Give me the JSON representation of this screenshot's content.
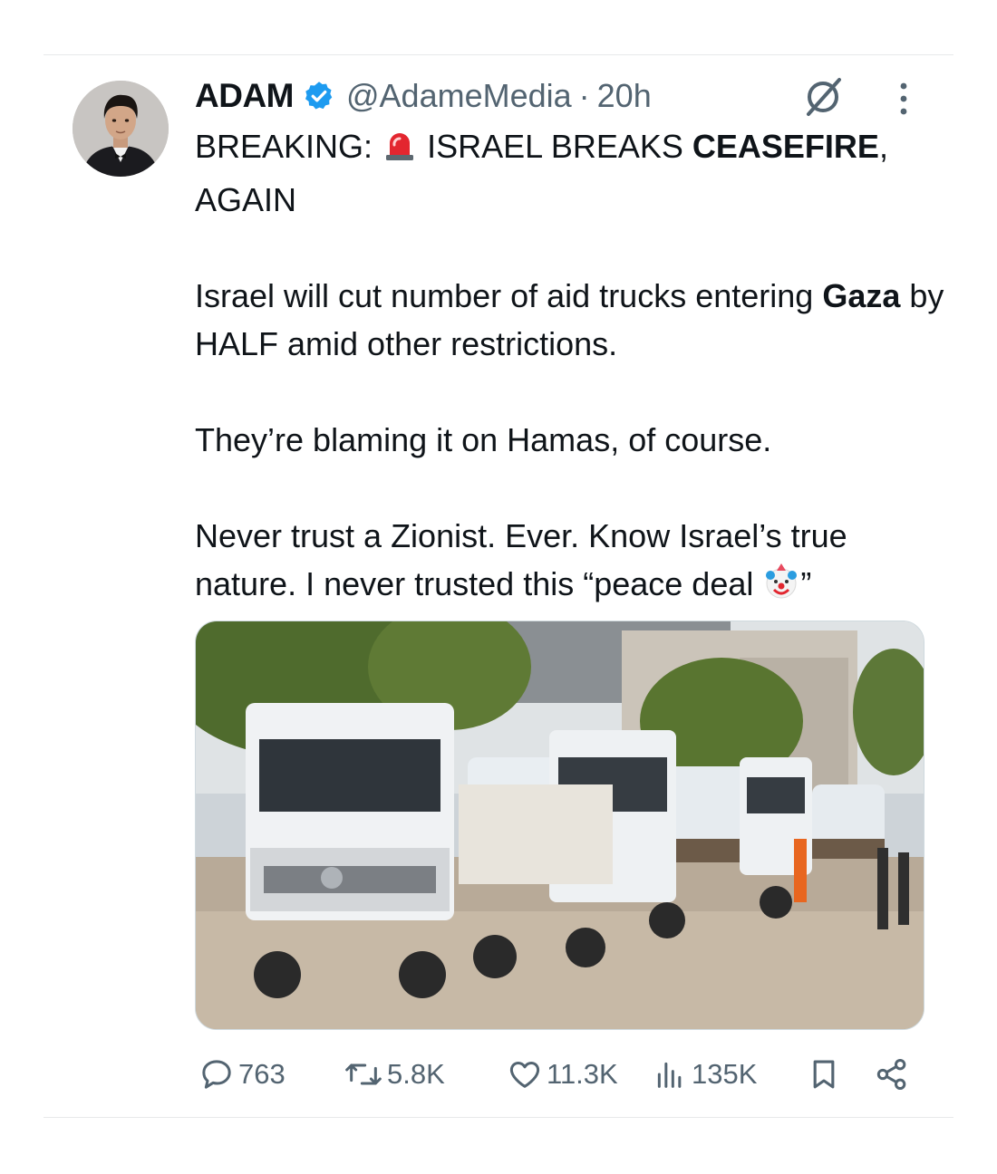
{
  "author": {
    "name": "ADAM",
    "handle": "@AdameMedia",
    "separator": "·",
    "time": "20h"
  },
  "tweet": {
    "line1_prefix": "BREAKING:",
    "line1_mid": "ISRAEL BREAKS",
    "line1_bold": "CEASEFIRE",
    "line1_suffix": ",",
    "line2": "AGAIN",
    "p2_text": "Israel will cut number of aid trucks entering",
    "p2_bold": "Gaza",
    "p2_rest": "by HALF amid other restrictions.",
    "p3": "They’re blaming it on Hamas, of course.",
    "p4_line1": "Never trust a Zionist. Ever. Know Israel’s true",
    "p4_line2": "nature. I never trusted this “peace deal",
    "p4_close": "”"
  },
  "icons": {
    "verified": "verified-badge-icon",
    "siren": "police-light-emoji",
    "clown": "clown-face-emoji",
    "grok": "grok-icon",
    "more": "more-options-icon",
    "reply": "reply-icon",
    "retweet": "retweet-icon",
    "like": "like-icon",
    "views": "views-icon",
    "bookmark": "bookmark-icon",
    "share": "share-icon"
  },
  "stats": {
    "replies": "763",
    "retweets": "5.8K",
    "likes": "11.3K",
    "views": "135K"
  },
  "colors": {
    "verified": "#1d9bf0",
    "secondary_text": "#536471",
    "primary_text": "#0f1419"
  }
}
